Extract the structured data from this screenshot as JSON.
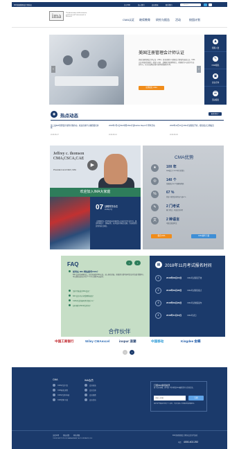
{
  "topbar": {
    "site_name": "IMA美国管理会计师协会",
    "links": [
      "关于IMA",
      "加入我们",
      "会员登录",
      "联系我们"
    ],
    "search_placeholder": "Search"
  },
  "header": {
    "logo": "ima",
    "logo_tagline": "The Association of Accountants and Financial Professionals in Business",
    "nav": [
      "CMA认证",
      "继续教育",
      "研究与报告",
      "活动",
      "校园计划"
    ]
  },
  "hero": {
    "title": "美国注册管理会计师认证",
    "paragraph": "美国注册管理会计师认证（CMA）是全球财务与管理会计领域的权威认证。CMA认证考核财务规划、绩效与分析、战略财务管理等能力，帮助财务人员提升专业竞争力，在企业战略决策中发挥更重要的作用。",
    "cta_label": "立即报名 CMA",
    "prev": "‹",
    "next": "›"
  },
  "side_panel": {
    "items": [
      {
        "label": "招募入会",
        "icon": "user-icon",
        "glyph": "♟"
      },
      {
        "label": "CMA报名",
        "icon": "document-icon",
        "glyph": "✎"
      },
      {
        "label": "企业合作",
        "icon": "building-icon",
        "glyph": "▣"
      },
      {
        "label": "活动报名",
        "icon": "calendar-icon",
        "glyph": "☰"
      }
    ]
  },
  "news": {
    "title": "热点动态",
    "more_label": "更多资讯 >",
    "items": [
      {
        "text": "第二届IMA管理会计案例大赛启动，欢迎高校学子踊跃报名参赛",
        "date": "2018-08-27"
      },
      {
        "text": "2018年7月2日IMA中国CMA考试Fairfax Report十周年活动",
        "date": "2018-08-16"
      },
      {
        "text": "2018年11月10日CMA考试报名开启，报名截止日期临近",
        "date": "2018-08-06"
      }
    ]
  },
  "video": {
    "name_line1": "Jeffrey c. thomson",
    "name_line2": "CMA,CSCA,CAE",
    "role": "President and CEO, IMA",
    "play": "▶",
    "banner": "欢迎加入IMA大家庭"
  },
  "magazine": {
    "issue": "07",
    "title": "战略财务杂志",
    "issue_month": "2018年7月",
    "description": "《战略财务》是IMA面向中国财务人员发行的专业月刊，涵盖管理会计、战略财务、技术变革等热点议题，为读者提供实用的前沿洞见。"
  },
  "advantage": {
    "title": "CMA优势",
    "rows": [
      {
        "big": "100 年",
        "small": "IMA成立于1919年历史悠久",
        "glyph": "★"
      },
      {
        "big": "140 个",
        "small": "全球超过140个国家和地区",
        "glyph": "◎"
      },
      {
        "big": "67 %",
        "small": "持证人薪资比非持证人高67%",
        "glyph": "%"
      },
      {
        "big": "2 门考试",
        "small": "两门考试，中英文皆可考",
        "glyph": "✎"
      },
      {
        "big": "2 种语言",
        "small": "中英文双语考试",
        "glyph": "文"
      }
    ],
    "btn_left": "报名CMA",
    "btn_right": "CMA资料下载"
  },
  "faq": {
    "title": "FAQ",
    "prev": "‹",
    "next": "›",
    "question": "如何在 IMA 网站报考CMA？",
    "answer": "IMA 会员登录网站后，在首页选择CMA认证，进入报名页面，按照提示填写报考信息并完成付费即可。考试报名成功后可在个人中心查看考试安排。",
    "links": [
      "怎样才能成为IMA会员？",
      "IMA 会员可以享受哪些权益？",
      "CMA考试的报考条件是什么？",
      "如何预约CMA考试时间？"
    ]
  },
  "exam": {
    "title": "2018年11月考试报名时间",
    "rows": [
      {
        "num": "1",
        "date": "2018年08月15日",
        "desc": "CMA考试报名开放"
      },
      {
        "num": "2",
        "date": "2018年09月28日",
        "desc": "CMA考试报名截止"
      },
      {
        "num": "3",
        "date": "2018年09月29日",
        "desc": "CMA考试成绩发布"
      },
      {
        "num": "4",
        "date": "2018年11月10日",
        "desc": "CMA考试日"
      }
    ]
  },
  "partners": {
    "title": "合作伙伴",
    "logos": [
      {
        "text": "中国工商银行",
        "color": "#c1272d"
      },
      {
        "text": "Wiley CMAexcel",
        "color": "#2f6db5"
      },
      {
        "text": "inspur 浪潮",
        "color": "#1b3a6b"
      },
      {
        "text": "中国移动",
        "color": "#2c9ad6"
      },
      {
        "text": "Kingdee 金蝶",
        "color": "#1e5aa8"
      }
    ],
    "prev": "‹",
    "next": "›"
  },
  "footer": {
    "col1_title": "CMA",
    "col1_links": [
      "CMA考试介绍",
      "CMA报名流程",
      "CMA考试时间表",
      "CMA资料下载"
    ],
    "col2_title": "IMA会员",
    "col2_links": [
      "会员权益",
      "会员注册",
      "会员续费",
      "会员活动"
    ],
    "subscribe_title": "订阅IMA新闻资讯",
    "subscribe_desc": "留下您的邮箱，即可第一时间获取IMA最新资讯与活动信息。",
    "email_placeholder": "请输入邮箱",
    "subscribe_btn": "订阅",
    "subscribe_note": "我们将严格保护您的个人信息，不会向第三方泄露您的邮箱地址。",
    "bottom_links": [
      "法律声明",
      "隐私政策",
      "网站地图"
    ],
    "copyright": "©2018 INSTITUTE OF MANAGEMENT ACCOUNTANTS, INC.",
    "address": "IMA美国管理会计师协会北京代表处",
    "phone_label": "电话",
    "phone": "4000-402-292"
  }
}
